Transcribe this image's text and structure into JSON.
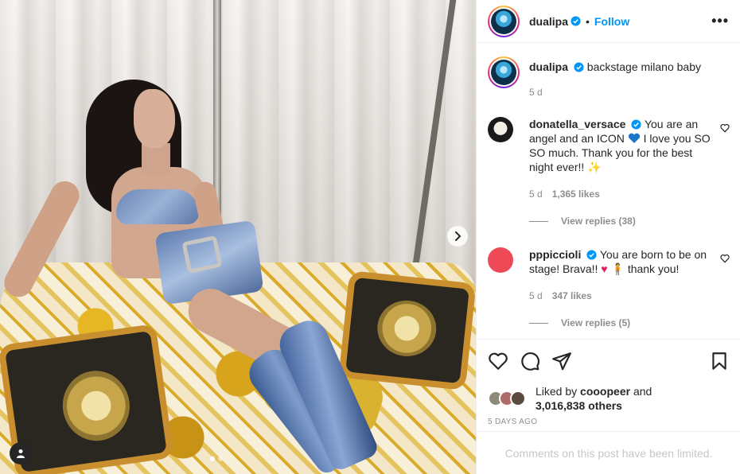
{
  "post": {
    "username": "dualipa",
    "follow_label": "Follow",
    "separator": "•",
    "more_label": "•••"
  },
  "caption": {
    "username": "dualipa",
    "text": "backstage milano baby",
    "age": "5 d"
  },
  "comments": [
    {
      "username": "donatella_versace",
      "text_before_heart": "You are an angel and an ICON",
      "text_after_heart": "I love you SO SO much. Thank you for the best night ever!!",
      "emoji_end": "✨",
      "age": "5 d",
      "likes": "1,365 likes",
      "view_replies": "View replies (38)"
    },
    {
      "username": "pppiccioli",
      "text_before_heart": "You are born to be on stage! Brava!!",
      "text_after_heart": "thank you!",
      "emoji_heart": "♥",
      "emoji_person": "🧍",
      "age": "5 d",
      "likes": "347 likes",
      "view_replies": "View replies (5)"
    }
  ],
  "likes": {
    "prefix": "Liked by",
    "user": "cooopeer",
    "and": "and",
    "count": "3,016,838 others"
  },
  "date": "5 DAYS AGO",
  "comments_limited": "Comments on this post have been limited.",
  "colors": {
    "accent": "#0095f6",
    "verified": "#0095f6",
    "heart_blue": "#1d76c9",
    "heart_red": "#e0245e",
    "pppiccioli_avatar": "#ed4956"
  },
  "icons": [
    "verified-icon",
    "more-options-icon",
    "heart-icon",
    "comment-icon",
    "share-icon",
    "save-icon",
    "chevron-right-icon",
    "user-tag-icon",
    "small-heart-icon"
  ],
  "carousel": {
    "slides": 2,
    "active": 1
  }
}
